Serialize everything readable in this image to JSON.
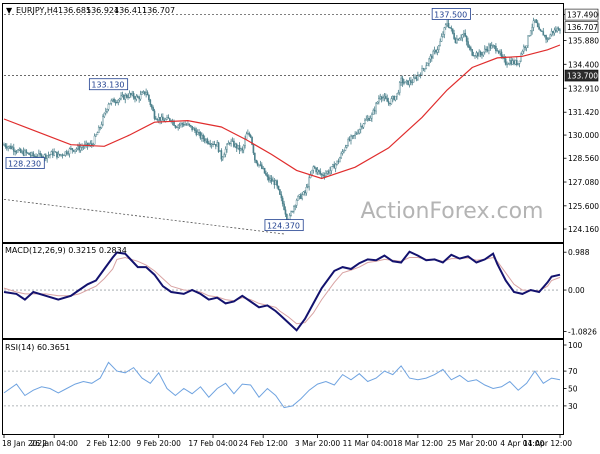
{
  "chart_data": {
    "type": "candlestick",
    "symbol": "EURJPY",
    "timeframe": "H4",
    "header": {
      "caret": "▼",
      "symbol_label": "EURJPY,H4",
      "open": "136.685",
      "high": "136.924",
      "low": "136.411",
      "close": "136.707"
    },
    "watermark": "ActionForex.com",
    "price_axis": {
      "ylim": [
        123.6,
        137.9
      ],
      "ticks": [
        "137.490",
        "135.880",
        "134.400",
        "132.910",
        "131.420",
        "130.000",
        "128.560",
        "127.080",
        "125.600",
        "124.160"
      ],
      "highlight_labels": [
        {
          "text": "137.490",
          "style": "light"
        },
        {
          "text": "136.707",
          "style": "light"
        },
        {
          "text": "133.700",
          "style": "dark"
        }
      ]
    },
    "horizontal_levels": [
      137.49,
      133.7
    ],
    "trend_line": {
      "from": 126.0,
      "to": 123.85
    },
    "annotations": [
      {
        "text": "137.500",
        "x": 107,
        "y": 137.5
      },
      {
        "text": "133.130",
        "x": 25,
        "y": 133.13
      },
      {
        "text": "128.230",
        "x": 4,
        "y": 128.23
      },
      {
        "text": "124.370",
        "x": 67,
        "y": 124.37
      }
    ],
    "price_series": {
      "x": [
        0,
        2,
        4,
        5,
        7,
        10,
        12,
        13,
        16,
        18,
        19,
        21,
        23,
        25,
        26,
        28,
        30,
        32,
        34,
        36,
        38,
        40,
        41,
        43,
        44,
        46,
        47,
        49,
        51,
        52,
        54,
        57,
        58,
        59,
        60,
        62,
        63,
        65,
        66,
        67,
        68,
        69,
        70,
        72,
        74,
        76,
        78,
        80,
        82,
        84,
        86,
        88,
        90,
        92,
        94,
        95,
        96,
        98,
        100,
        102,
        104,
        105,
        106,
        107,
        108,
        110,
        111,
        112,
        114,
        116,
        118,
        119,
        120,
        121,
        122,
        123,
        124,
        125,
        126,
        127,
        128,
        129,
        130,
        131,
        132,
        133
      ],
      "close": [
        129.4,
        129.2,
        128.9,
        128.9,
        128.7,
        128.7,
        128.9,
        128.7,
        129.1,
        129.2,
        129.3,
        129.4,
        130.5,
        132.0,
        132.1,
        132.3,
        132.5,
        132.3,
        132.7,
        131.2,
        130.9,
        131.0,
        130.6,
        130.7,
        130.6,
        130.2,
        129.9,
        129.6,
        129.4,
        128.6,
        129.6,
        129.0,
        130.0,
        130.0,
        128.5,
        127.8,
        127.3,
        127.0,
        126.2,
        125.5,
        124.6,
        125.4,
        126.0,
        126.4,
        128.0,
        127.5,
        127.8,
        128.4,
        129.5,
        130.0,
        130.8,
        131.2,
        132.5,
        132.0,
        132.5,
        133.4,
        133.2,
        133.4,
        134.0,
        134.8,
        135.5,
        136.3,
        137.0,
        136.5,
        135.9,
        136.3,
        135.5,
        135.1,
        135.0,
        135.5,
        135.4,
        134.8,
        134.5,
        134.6,
        134.5,
        134.5,
        135.3,
        135.7,
        136.6,
        137.1,
        136.4,
        136.3,
        135.9,
        136.4,
        136.5,
        136.7
      ],
      "ma_x": [
        0,
        8,
        16,
        24,
        30,
        36,
        44,
        52,
        58,
        64,
        70,
        76,
        84,
        92,
        100,
        106,
        112,
        118,
        124,
        130,
        133
      ],
      "ma": [
        131.0,
        130.2,
        129.4,
        129.3,
        130.0,
        130.8,
        130.9,
        130.5,
        129.7,
        128.8,
        127.8,
        127.3,
        128.0,
        129.2,
        131.1,
        132.8,
        134.2,
        134.8,
        134.9,
        135.3,
        135.6
      ]
    },
    "macd": {
      "title": "MACD(12,26,9) 0.3215 0.2834",
      "ylim": [
        -1.2,
        1.15
      ],
      "ticks": [
        "0.988",
        "0.00",
        "-1.0826"
      ],
      "tick_values": [
        0.988,
        0.0,
        -1.0826
      ],
      "x": [
        0,
        3,
        5,
        7,
        10,
        13,
        16,
        18,
        20,
        22,
        24,
        26,
        27,
        29,
        32,
        34,
        36,
        38,
        40,
        43,
        45,
        47,
        49,
        51,
        53,
        55,
        57,
        59,
        61,
        63,
        65,
        66,
        68,
        70,
        72,
        74,
        76,
        79,
        81,
        83,
        85,
        87,
        89,
        91,
        93,
        95,
        97,
        99,
        101,
        103,
        105,
        107,
        109,
        111,
        113,
        115,
        117,
        118,
        120,
        122,
        124,
        126,
        128,
        130,
        131,
        133
      ],
      "main": [
        -0.05,
        -0.1,
        -0.25,
        -0.05,
        -0.15,
        -0.25,
        -0.15,
        0.0,
        0.15,
        0.25,
        0.55,
        0.85,
        0.98,
        0.95,
        0.6,
        0.6,
        0.4,
        0.1,
        -0.05,
        -0.1,
        0.0,
        -0.1,
        -0.25,
        -0.2,
        -0.35,
        -0.3,
        -0.15,
        -0.3,
        -0.45,
        -0.4,
        -0.55,
        -0.65,
        -0.85,
        -1.05,
        -0.75,
        -0.35,
        0.05,
        0.5,
        0.6,
        0.55,
        0.7,
        0.8,
        0.78,
        0.9,
        0.75,
        0.72,
        1.0,
        0.9,
        0.78,
        0.8,
        0.72,
        0.92,
        0.82,
        0.88,
        0.72,
        0.8,
        0.95,
        0.68,
        0.25,
        -0.05,
        -0.1,
        0.0,
        -0.05,
        0.2,
        0.35,
        0.4
      ],
      "signal": [
        0.05,
        -0.05,
        -0.1,
        -0.1,
        -0.1,
        -0.15,
        -0.15,
        -0.1,
        0.0,
        0.1,
        0.3,
        0.55,
        0.8,
        0.85,
        0.75,
        0.65,
        0.5,
        0.3,
        0.1,
        0.0,
        -0.02,
        -0.05,
        -0.15,
        -0.18,
        -0.25,
        -0.28,
        -0.2,
        -0.25,
        -0.35,
        -0.4,
        -0.45,
        -0.55,
        -0.7,
        -0.88,
        -0.85,
        -0.6,
        -0.25,
        0.2,
        0.45,
        0.52,
        0.6,
        0.72,
        0.75,
        0.8,
        0.78,
        0.75,
        0.85,
        0.85,
        0.8,
        0.8,
        0.75,
        0.82,
        0.82,
        0.84,
        0.78,
        0.8,
        0.85,
        0.75,
        0.45,
        0.15,
        0.0,
        -0.02,
        -0.02,
        0.1,
        0.25,
        0.33
      ]
    },
    "rsi": {
      "title": "RSI(14) 60.3651",
      "ylim": [
        0,
        100
      ],
      "ticks": [
        "100",
        "70",
        "50",
        "30",
        "0"
      ],
      "tick_values": [
        100,
        70,
        50,
        30,
        0
      ],
      "x": [
        0,
        3,
        5,
        7,
        9,
        11,
        13,
        15,
        17,
        19,
        21,
        23,
        25,
        27,
        29,
        31,
        33,
        35,
        37,
        39,
        41,
        43,
        45,
        47,
        49,
        51,
        53,
        55,
        57,
        59,
        61,
        63,
        65,
        67,
        69,
        71,
        73,
        75,
        77,
        79,
        81,
        83,
        85,
        87,
        89,
        91,
        93,
        95,
        97,
        99,
        101,
        103,
        105,
        107,
        109,
        111,
        113,
        115,
        117,
        119,
        121,
        123,
        125,
        127,
        129,
        131,
        133
      ],
      "values": [
        45,
        55,
        42,
        48,
        52,
        50,
        45,
        50,
        55,
        58,
        56,
        62,
        80,
        70,
        68,
        74,
        62,
        56,
        68,
        50,
        42,
        50,
        44,
        52,
        40,
        50,
        56,
        44,
        55,
        54,
        40,
        50,
        42,
        28,
        30,
        38,
        48,
        55,
        58,
        54,
        66,
        60,
        67,
        58,
        62,
        70,
        66,
        76,
        62,
        60,
        62,
        66,
        72,
        60,
        65,
        58,
        60,
        54,
        50,
        52,
        58,
        48,
        56,
        70,
        56,
        62,
        60
      ]
    },
    "x_axis": {
      "labels": [
        "18 Jan 2022",
        "26 Jan 04:00",
        "2 Feb 12:00",
        "9 Feb 20:00",
        "17 Feb 04:00",
        "24 Feb 12:00",
        "3 Mar 20:00",
        "11 Mar 04:00",
        "18 Mar 12:00",
        "25 Mar 20:00",
        "4 Apr 04:00",
        "11 Apr 12:00"
      ],
      "label_x": [
        0,
        12,
        25,
        37,
        50,
        62,
        75,
        87,
        99,
        112,
        124,
        133
      ]
    },
    "colors": {
      "candle": "#4a7f8a",
      "ma": "#e02d2d",
      "macd_main": "#13126e",
      "macd_signal": "#d9a3a3",
      "rsi": "#6fa3e0",
      "watermark": "#b4b4b4",
      "axis": "#000000",
      "grid_dashed": "#9aa0a6",
      "label_box": "#1f3f8f"
    }
  }
}
